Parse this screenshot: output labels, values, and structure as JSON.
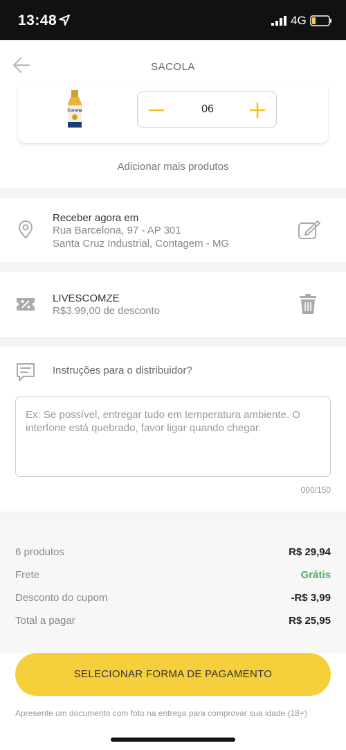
{
  "status_bar": {
    "time": "13:48",
    "network": "4G"
  },
  "header": {
    "title": "SACOLA"
  },
  "product": {
    "image_label": "Corona",
    "quantity": "06"
  },
  "add_more": "Adicionar mais produtos",
  "address": {
    "title": "Receber agora em",
    "street": "Rua Barcelona, 97 - AP 301",
    "city": "Santa Cruz Industrial, Contagem - MG"
  },
  "coupon": {
    "code": "LIVESCOMZE",
    "description": "R$3.99,00 de desconto"
  },
  "notes": {
    "label": "Instruções para o distribuidor?",
    "placeholder": "Ex: Se possível, entregar tudo em temperatura ambiente. O interfone está quebrado, favor ligar quando chegar.",
    "counter": "000/150"
  },
  "summary": {
    "products_label": "6 produtos",
    "products_value": "R$ 29,94",
    "shipping_label": "Frete",
    "shipping_value": "Grátis",
    "discount_label": "Desconto do cupom",
    "discount_value": "-R$ 3,99",
    "total_label": "Total a pagar",
    "total_value": "R$ 25,95"
  },
  "pay_button": "SELECIONAR FORMA DE PAGAMENTO",
  "disclaimer": "Apresente um documento com foto na entrega para comprovar sua idade (18+)",
  "colors": {
    "accent": "#f5cf3c",
    "free": "#48b261",
    "stepper_icon": "#f2c318"
  },
  "icons": [
    "location-arrow-icon",
    "signal-icon",
    "battery-icon",
    "back-arrow-icon",
    "minus-icon",
    "plus-icon",
    "location-pin-icon",
    "edit-icon",
    "coupon-icon",
    "trash-icon",
    "chat-icon"
  ]
}
